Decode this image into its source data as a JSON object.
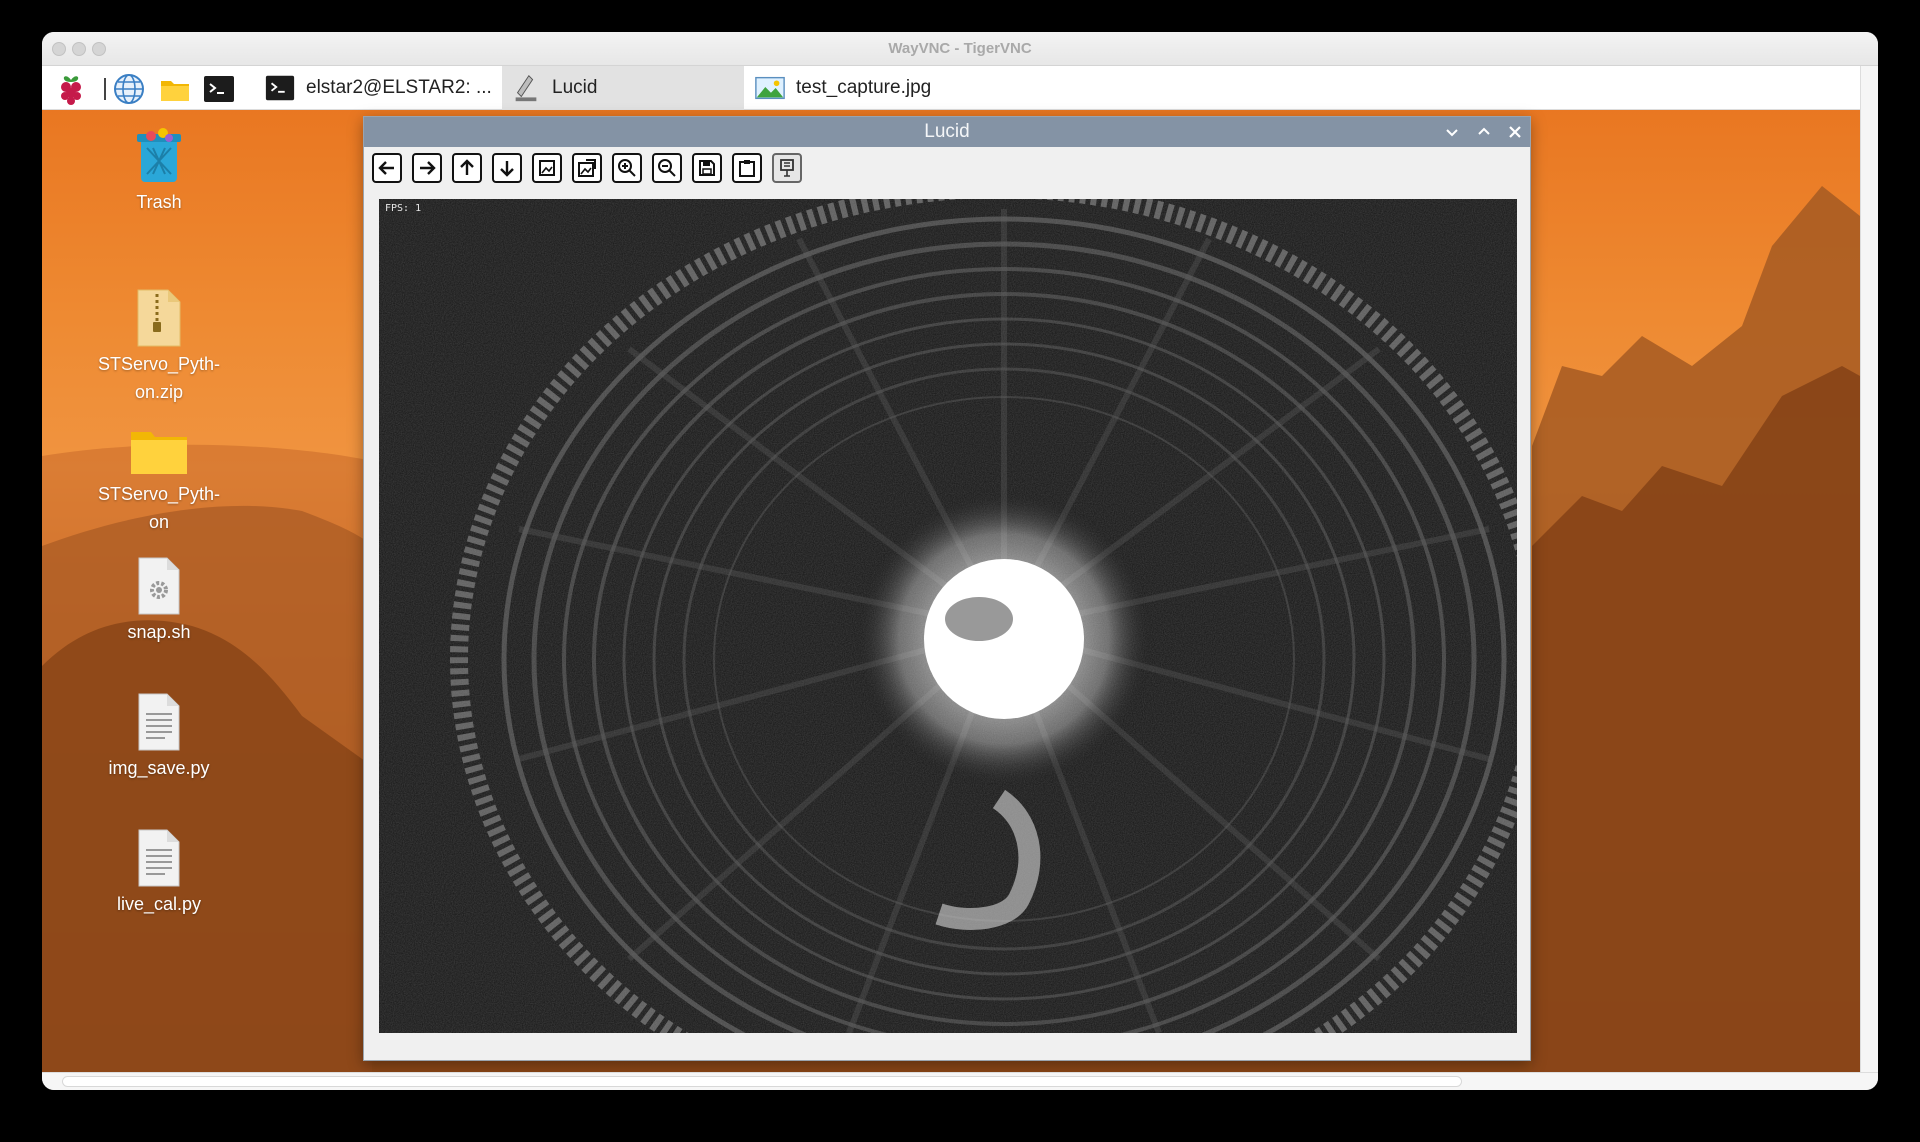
{
  "vnc": {
    "title": "WayVNC - TigerVNC"
  },
  "taskbar": {
    "launchers": [
      {
        "name": "raspberry-menu-icon"
      },
      {
        "name": "browser-globe-icon"
      },
      {
        "name": "file-manager-folder-icon"
      },
      {
        "name": "terminal-icon"
      }
    ],
    "tasks": [
      {
        "label": "elstar2@ELSTAR2: ...",
        "icon": "terminal-icon",
        "active": false
      },
      {
        "label": "Lucid",
        "icon": "python-app-icon",
        "active": true
      },
      {
        "label": "test_capture.jpg",
        "icon": "image-viewer-icon",
        "active": false
      }
    ]
  },
  "desktop": {
    "icons": [
      {
        "label": "Trash",
        "icon": "trash-icon"
      },
      {
        "label": "STServo_Pyth-\non.zip",
        "icon": "zip-file-icon"
      },
      {
        "label": "STServo_Pyth-\non",
        "icon": "folder-icon"
      },
      {
        "label": "snap.sh",
        "icon": "script-file-icon"
      },
      {
        "label": "img_save.py",
        "icon": "text-file-icon"
      },
      {
        "label": "live_cal.py",
        "icon": "text-file-icon"
      }
    ]
  },
  "app": {
    "title": "Lucid",
    "toolbar": [
      "arrow-left-icon",
      "arrow-right-icon",
      "arrow-up-icon",
      "arrow-down-icon",
      "fit-image-icon",
      "reset-view-icon",
      "zoom-in-icon",
      "zoom-out-icon",
      "save-icon",
      "clipboard-icon",
      "settings-icon"
    ],
    "fps": "FPS: 1"
  },
  "colors": {
    "desktop_orange": "#ee8a32",
    "app_titlebar": "#8493a5",
    "viewer_bg": "#121212"
  }
}
